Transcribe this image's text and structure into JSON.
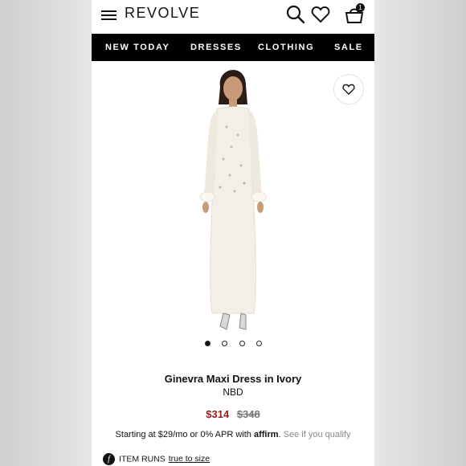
{
  "header": {
    "logo": "REVOLVE",
    "cart_count": "1",
    "icons": [
      "menu-icon",
      "search-icon",
      "heart-icon",
      "shopping-bag-icon"
    ]
  },
  "nav": {
    "items": [
      "NEW TODAY",
      "DRESSES",
      "CLOTHING",
      "SALE"
    ]
  },
  "product": {
    "image_dots": {
      "count": 4,
      "active_index": 0
    },
    "name": "Ginevra Maxi Dress in Ivory",
    "brand": "NBD",
    "price_sale": "$314",
    "price_original": "$348",
    "financing_prefix": "Starting at $29/mo or 0% APR with",
    "financing_logo": "affirm",
    "financing_link": "See if you qualify",
    "fit_label": "ITEM RUNS",
    "fit_value": "true to size",
    "colors": {
      "sale": "#9b1b1b",
      "nav_bg": "#000000",
      "dress": "#f4efe6"
    }
  }
}
